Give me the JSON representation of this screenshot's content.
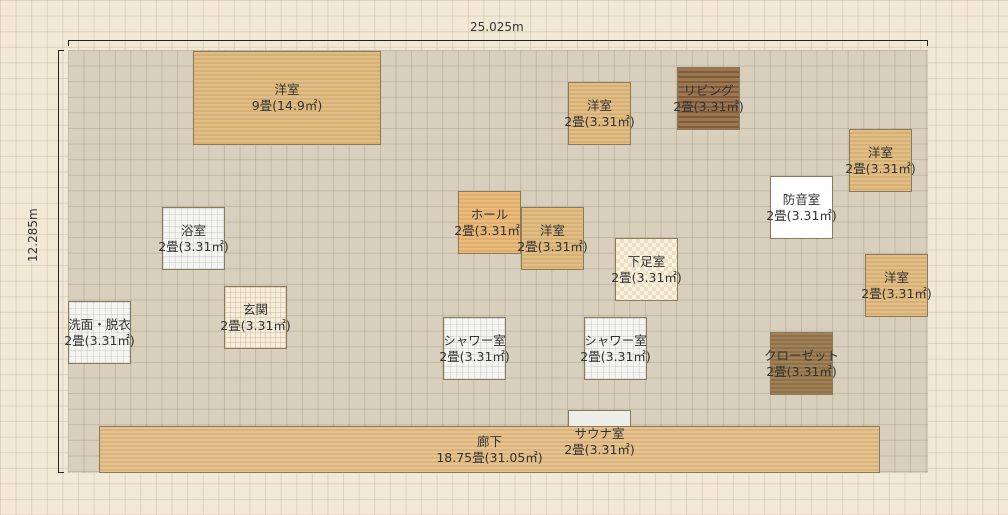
{
  "dimensions": {
    "width": "25.025m",
    "height": "12.285m"
  },
  "rooms": {
    "yoshitsu_large": {
      "name": "洋室",
      "area": "9畳(14.9㎡)"
    },
    "yoshitsu_1": {
      "name": "洋室",
      "area": "2畳(3.31㎡)"
    },
    "living": {
      "name": "リビング",
      "area": "2畳(3.31㎡)"
    },
    "yoshitsu_right_top": {
      "name": "洋室",
      "area": "2畳(3.31㎡)"
    },
    "boonshitsu": {
      "name": "防音室",
      "area": "2畳(3.31㎡)"
    },
    "yokushitsu": {
      "name": "浴室",
      "area": "2畳(3.31㎡)"
    },
    "hall": {
      "name": "ホール",
      "area": "2畳(3.31㎡)"
    },
    "yoshitsu_center": {
      "name": "洋室",
      "area": "2畳(3.31㎡)"
    },
    "shitasokushitsu": {
      "name": "下足室",
      "area": "2畳(3.31㎡)"
    },
    "yoshitsu_right_mid": {
      "name": "洋室",
      "area": "2畳(3.31㎡)"
    },
    "senmen": {
      "name": "洗面・脱衣",
      "area": "2畳(3.31㎡)"
    },
    "genkan": {
      "name": "玄関",
      "area": "2畳(3.31㎡)"
    },
    "shower_1": {
      "name": "シャワー室",
      "area": "2畳(3.31㎡)"
    },
    "shower_2": {
      "name": "シャワー室",
      "area": "2畳(3.31㎡)"
    },
    "closet": {
      "name": "クローゼット",
      "area": "2畳(3.31㎡)"
    },
    "corridor": {
      "name": "廊下",
      "area": "18.75畳(31.05㎡)"
    },
    "sauna": {
      "name": "サウナ室",
      "area": "2畳(3.31㎡)"
    }
  }
}
